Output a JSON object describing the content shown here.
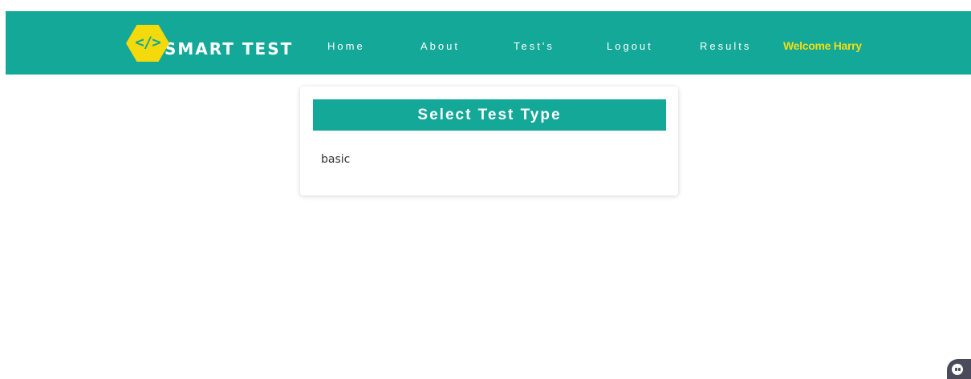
{
  "brand": {
    "logo_glyph": "</>",
    "name": "SMART TEST",
    "logo_color": "#f4d90b"
  },
  "nav": {
    "items": [
      {
        "label": "Home"
      },
      {
        "label": "About"
      },
      {
        "label": "Test's"
      },
      {
        "label": "Logout"
      },
      {
        "label": "Results"
      }
    ],
    "welcome": "Welcome Harry",
    "background_color": "#13a898",
    "welcome_color": "#f2df10"
  },
  "main": {
    "card_title": "Select Test Type",
    "test_types": [
      {
        "label": "basic"
      }
    ]
  },
  "chat_widget": {
    "icon": "chat-bot-icon"
  }
}
